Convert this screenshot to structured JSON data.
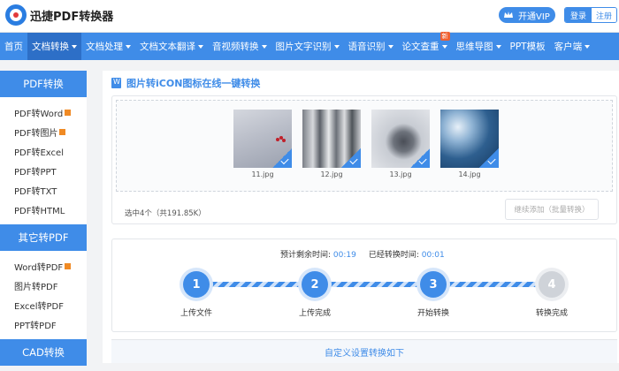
{
  "header": {
    "brand": "迅捷PDF转换器",
    "vip_label": "开通VIP",
    "login_label": "登录",
    "register_label": "注册",
    "logo_icon": "xunjie-logo-icon",
    "vip_icon": "crown-icon"
  },
  "nav": {
    "items": [
      {
        "label": "首页",
        "dropdown": false
      },
      {
        "label": "文档转换",
        "dropdown": true,
        "active": true
      },
      {
        "label": "文档处理",
        "dropdown": true
      },
      {
        "label": "文档文本翻译",
        "dropdown": true
      },
      {
        "label": "音视频转换",
        "dropdown": true
      },
      {
        "label": "图片文字识别",
        "dropdown": true
      },
      {
        "label": "语音识别",
        "dropdown": true
      },
      {
        "label": "论文查重",
        "dropdown": true,
        "badge": "新"
      },
      {
        "label": "思维导图",
        "dropdown": true
      },
      {
        "label": "PPT模板",
        "dropdown": false
      },
      {
        "label": "客户端",
        "dropdown": true
      }
    ],
    "accent_color": "#3f8ce8"
  },
  "sidebar": {
    "sections": [
      {
        "title": "PDF转换",
        "items": [
          {
            "label": "PDF转Word",
            "hot": true
          },
          {
            "label": "PDF转图片",
            "hot": true
          },
          {
            "label": "PDF转Excel",
            "hot": false
          },
          {
            "label": "PDF转PPT",
            "hot": false
          },
          {
            "label": "PDF转TXT",
            "hot": false
          },
          {
            "label": "PDF转HTML",
            "hot": false
          }
        ]
      },
      {
        "title": "其它转PDF",
        "items": [
          {
            "label": "Word转PDF",
            "hot": true
          },
          {
            "label": "图片转PDF",
            "hot": false
          },
          {
            "label": "Excel转PDF",
            "hot": false
          },
          {
            "label": "PPT转PDF",
            "hot": false
          }
        ]
      },
      {
        "title": "CAD转换",
        "items": []
      }
    ]
  },
  "main": {
    "title": "图片转iCON图标在线一键转换",
    "title_icon": "word-doc-icon",
    "files": [
      {
        "name": "11.jpg",
        "thumb": "snow-branch-berries"
      },
      {
        "name": "12.jpg",
        "thumb": "snowy-forest"
      },
      {
        "name": "13.jpg",
        "thumb": "person-in-snow"
      },
      {
        "name": "14.jpg",
        "thumb": "aerial-snow-road"
      }
    ],
    "selected_info": "选中4个（共191.85K）",
    "add_button": "继续添加（批量转换）",
    "remaining_label": "预计剩余时间:",
    "remaining_value": "00:19",
    "elapsed_label": "已经转换时间:",
    "elapsed_value": "00:01",
    "steps": [
      {
        "num": "1",
        "label": "上传文件",
        "done": true
      },
      {
        "num": "2",
        "label": "上传完成",
        "done": true
      },
      {
        "num": "3",
        "label": "开始转换",
        "done": true
      },
      {
        "num": "4",
        "label": "转换完成",
        "done": false
      }
    ],
    "custom_settings": "自定义设置转换如下"
  }
}
